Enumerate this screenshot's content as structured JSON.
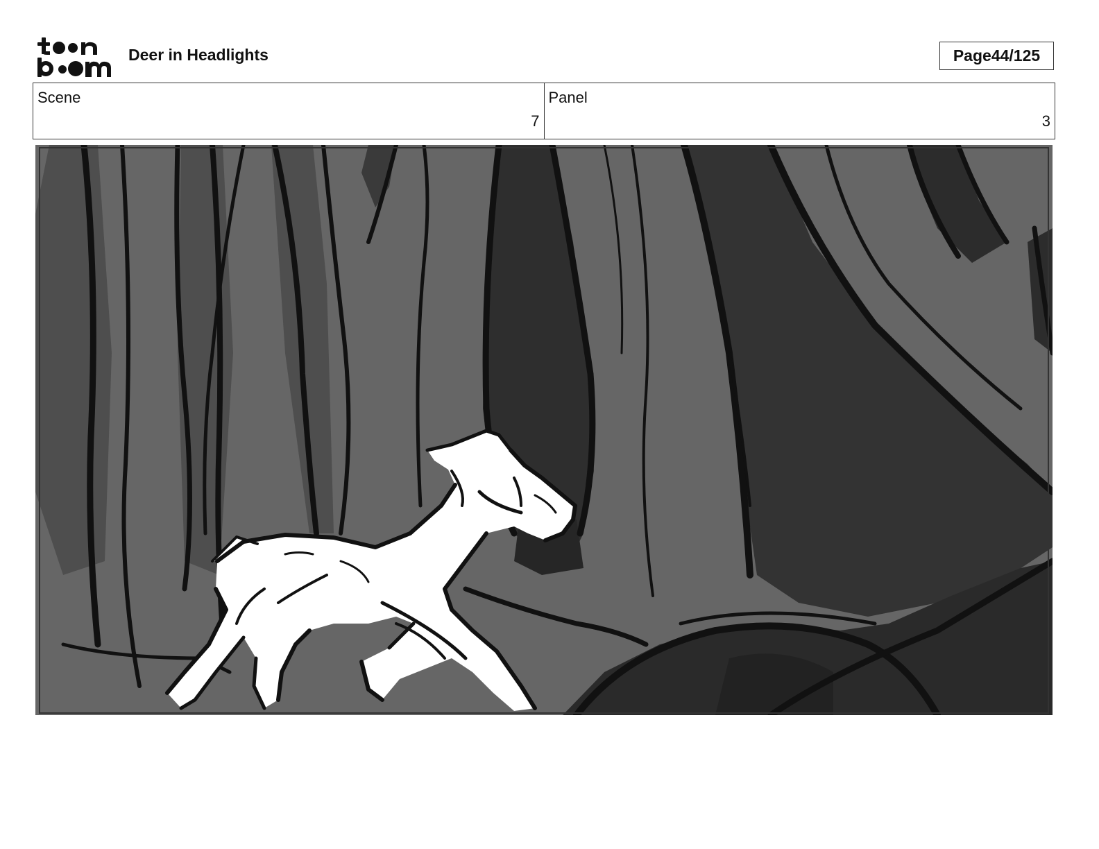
{
  "header": {
    "logo_text": "toon boom",
    "project_title": "Deer in Headlights",
    "page_label": "Page",
    "page_number": "44/125"
  },
  "info": {
    "scene_label": "Scene",
    "scene_value": "7",
    "panel_label": "Panel",
    "panel_value": "3"
  },
  "colors": {
    "ink": "#111111",
    "panel_background": "#666666",
    "dark_trunk": "#2e2e2e",
    "deer": "#ffffff"
  },
  "panel_image": {
    "icon": "storyboard-sketch-forest-deer"
  }
}
